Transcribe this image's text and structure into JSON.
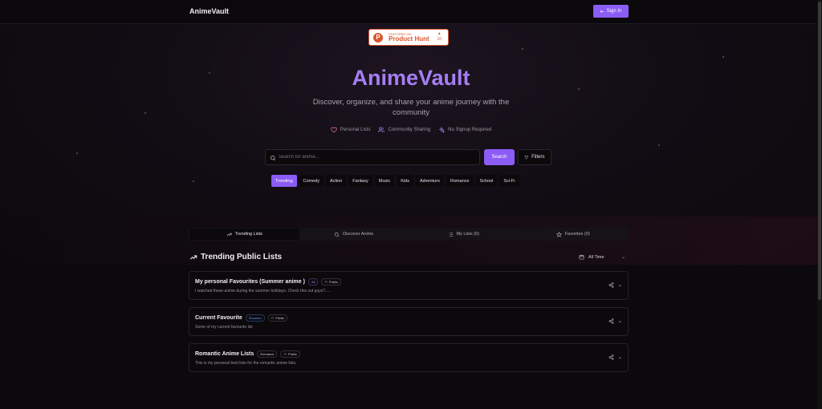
{
  "app": {
    "brand": "AnimeVault"
  },
  "nav": {
    "signin_label": "Sign In"
  },
  "product_hunt": {
    "featured": "FEATURED ON",
    "name": "Product Hunt",
    "votes": "10"
  },
  "hero": {
    "title": "AnimeVault",
    "subtitle": "Discover, organize, and share your anime journey with the community",
    "features": [
      {
        "label": "Personal Lists",
        "icon": "heart-icon"
      },
      {
        "label": "Community Sharing",
        "icon": "users-icon"
      },
      {
        "label": "No Signup Required",
        "icon": "sparkles-icon"
      }
    ]
  },
  "search": {
    "placeholder": "Search for anime...",
    "button": "Search",
    "filters": "Filters"
  },
  "genres": [
    "Trending",
    "Comedy",
    "Action",
    "Fantasy",
    "Music",
    "Kids",
    "Adventure",
    "Romance",
    "School",
    "Sci-Fi"
  ],
  "tabs": [
    {
      "label": "Trending Lists",
      "icon": "trending-up-icon",
      "active": true
    },
    {
      "label": "Discover Anime",
      "icon": "search-icon",
      "active": false
    },
    {
      "label": "My Lists (0)",
      "icon": "list-icon",
      "active": false
    },
    {
      "label": "Favorites (0)",
      "icon": "star-icon",
      "active": false
    }
  ],
  "section": {
    "title": "Trending Public Lists",
    "time_filter": "All Time"
  },
  "lists": [
    {
      "title": "My personal Favourites (Summer anime )",
      "tag": "All",
      "visibility": "Public",
      "description": "I watched these anime during the summer holidays. Check this out guys?....."
    },
    {
      "title": "Current Favourite",
      "tag": "Shounen",
      "visibility": "Public",
      "description": "Some of my current favourite list"
    },
    {
      "title": "Romantic Anime Lists",
      "tag": "Romance",
      "visibility": "Public",
      "description": "This is my personal best lists for the romantic anime lists."
    }
  ],
  "colors": {
    "accent": "#8b5cf6",
    "title": "#a57ef3",
    "background": "#0c090d"
  }
}
